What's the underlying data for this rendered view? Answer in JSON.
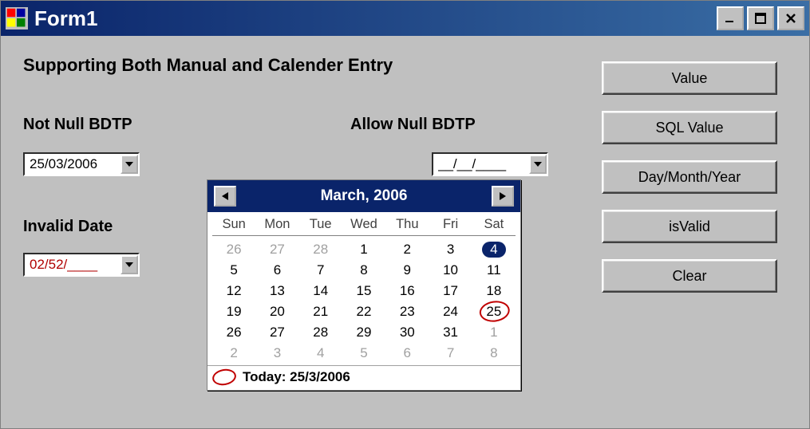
{
  "window": {
    "title": "Form1"
  },
  "heading": "Supporting Both Manual and Calender Entry",
  "labels": {
    "notNull": "Not Null BDTP",
    "allowNull": "Allow Null BDTP",
    "invalid": "Invalid Date"
  },
  "pickers": {
    "notNull": {
      "value": "25/03/2006"
    },
    "allowNull": {
      "value": "__/__/____"
    },
    "invalid": {
      "value": "02/52/____"
    }
  },
  "buttons": {
    "value": "Value",
    "sqlValue": "SQL Value",
    "dmy": "Day/Month/Year",
    "isValid": "isValid",
    "clear": "Clear"
  },
  "calendar": {
    "title": "March, 2006",
    "dow": [
      "Sun",
      "Mon",
      "Tue",
      "Wed",
      "Thu",
      "Fri",
      "Sat"
    ],
    "weeks": [
      [
        {
          "d": 26,
          "other": true
        },
        {
          "d": 27,
          "other": true
        },
        {
          "d": 28,
          "other": true
        },
        {
          "d": 1
        },
        {
          "d": 2
        },
        {
          "d": 3
        },
        {
          "d": 4,
          "selected": true
        }
      ],
      [
        {
          "d": 5
        },
        {
          "d": 6
        },
        {
          "d": 7
        },
        {
          "d": 8
        },
        {
          "d": 9
        },
        {
          "d": 10
        },
        {
          "d": 11
        }
      ],
      [
        {
          "d": 12
        },
        {
          "d": 13
        },
        {
          "d": 14
        },
        {
          "d": 15
        },
        {
          "d": 16
        },
        {
          "d": 17
        },
        {
          "d": 18
        }
      ],
      [
        {
          "d": 19
        },
        {
          "d": 20
        },
        {
          "d": 21
        },
        {
          "d": 22
        },
        {
          "d": 23
        },
        {
          "d": 24
        },
        {
          "d": 25,
          "today": true
        }
      ],
      [
        {
          "d": 26
        },
        {
          "d": 27
        },
        {
          "d": 28
        },
        {
          "d": 29
        },
        {
          "d": 30
        },
        {
          "d": 31
        },
        {
          "d": 1,
          "other": true
        }
      ],
      [
        {
          "d": 2,
          "other": true
        },
        {
          "d": 3,
          "other": true
        },
        {
          "d": 4,
          "other": true
        },
        {
          "d": 5,
          "other": true
        },
        {
          "d": 6,
          "other": true
        },
        {
          "d": 7,
          "other": true
        },
        {
          "d": 8,
          "other": true
        }
      ]
    ],
    "todayLabel": "Today: 25/3/2006"
  }
}
